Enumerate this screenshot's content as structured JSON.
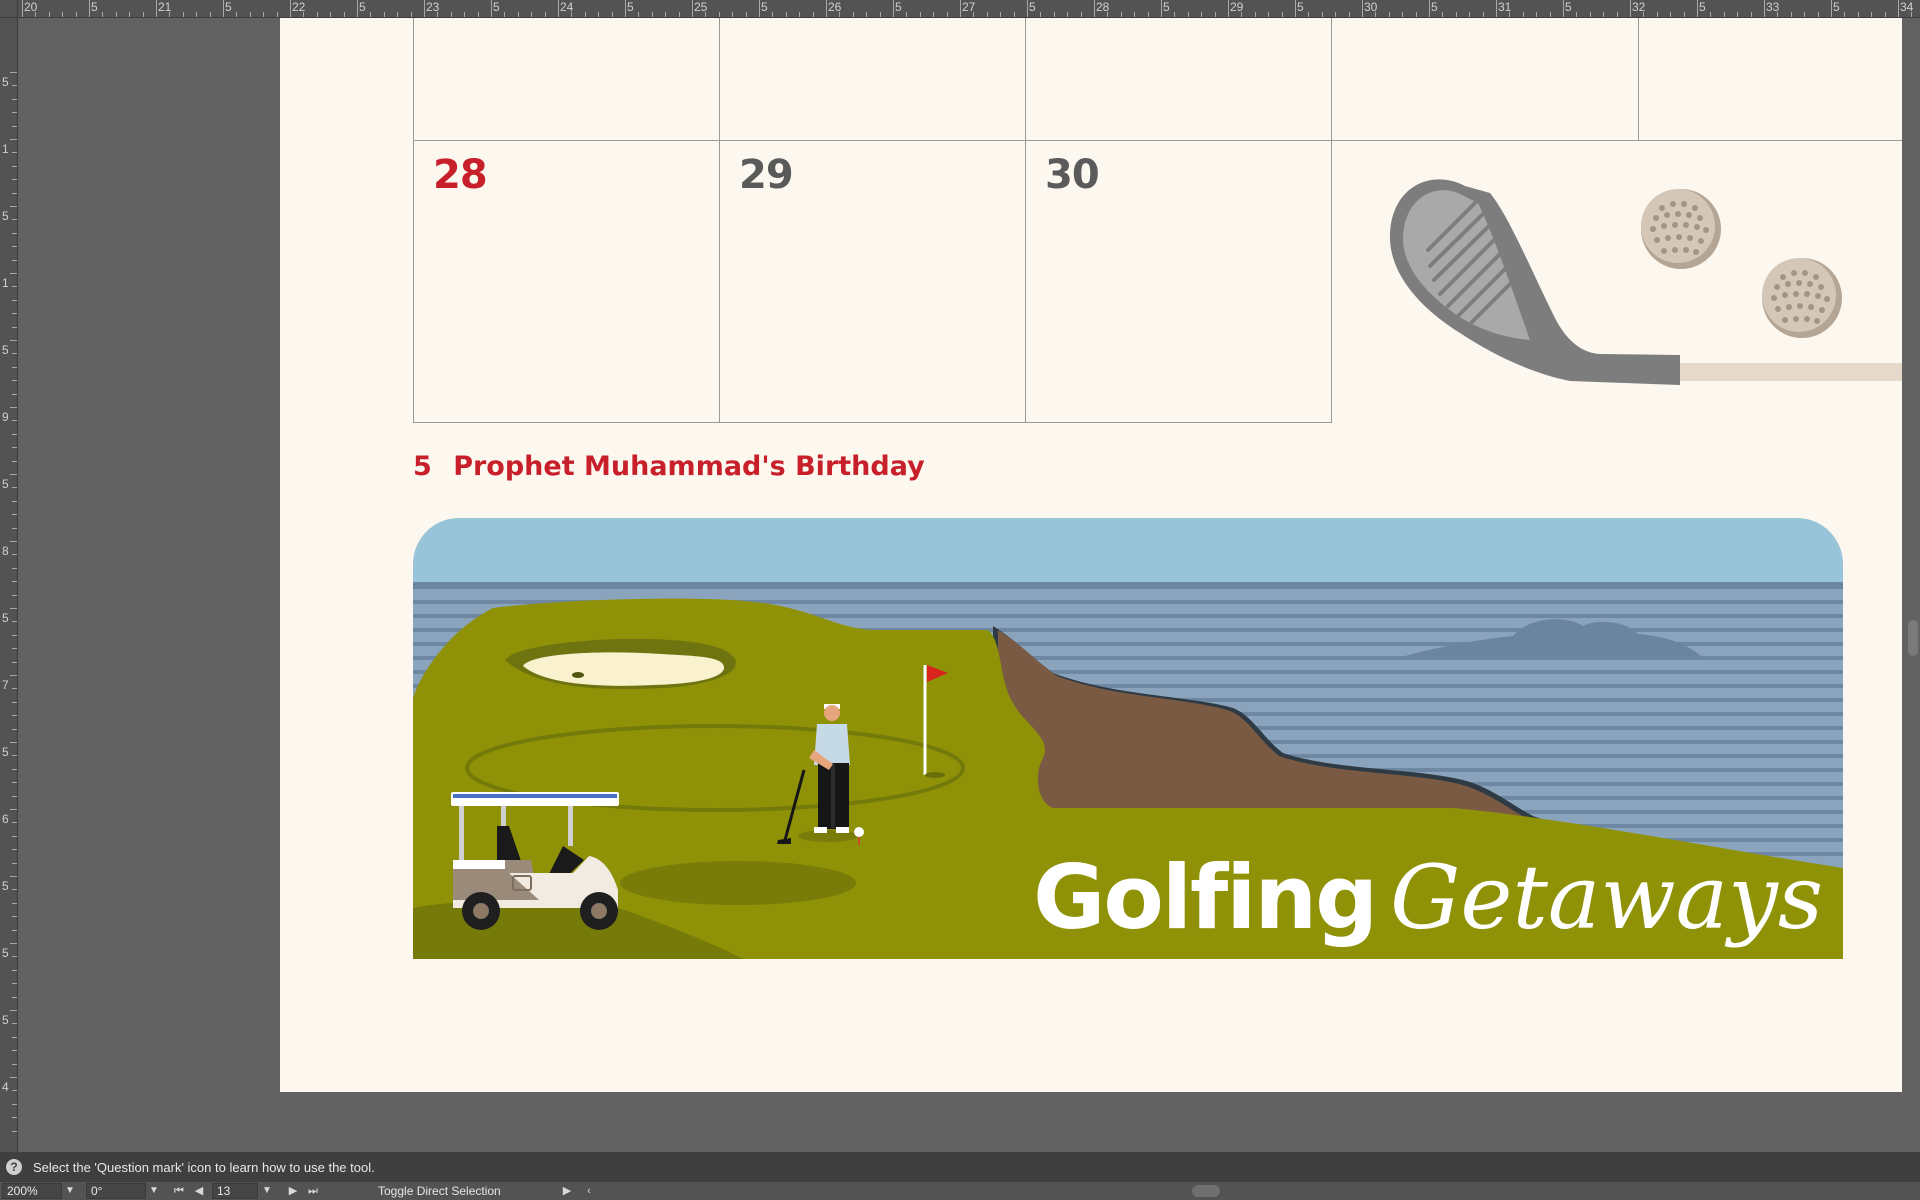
{
  "ruler_top": {
    "labels": [
      "20",
      "5",
      "21",
      "5",
      "22",
      "5",
      "23",
      "5",
      "24",
      "5",
      "25",
      "5",
      "26",
      "5",
      "27",
      "5",
      "28",
      "5",
      "29",
      "5",
      "30",
      "5",
      "31",
      "5",
      "32",
      "5",
      "33",
      "5",
      "34"
    ]
  },
  "ruler_left": {
    "labels": [
      "5",
      "1",
      "5",
      "1",
      "5",
      "9",
      "5",
      "8",
      "5",
      "7",
      "5",
      "6",
      "5",
      "5",
      "5",
      "4"
    ]
  },
  "calendar": {
    "days": [
      {
        "num": "28",
        "color": "#c8202a"
      },
      {
        "num": "29",
        "color": "#5a5a5a"
      },
      {
        "num": "30",
        "color": "#5a5a5a"
      }
    ]
  },
  "holiday": {
    "day": "5",
    "name": "Prophet Muhammad's Birthday"
  },
  "banner": {
    "title_plain": "Golfing",
    "title_italic": "Getaways"
  },
  "hint": {
    "icon": "question-mark-icon",
    "text": "Select the 'Question mark' icon to learn how to use the tool."
  },
  "status": {
    "zoom": "200%",
    "rotation": "0°",
    "page": "13",
    "tool_label": "Toggle Direct Selection"
  },
  "colors": {
    "pasteboard": "#626262",
    "page": "#fdf8ef",
    "accent_red": "#c8202a",
    "grass": "#8f9207",
    "sky": "#97c4d8",
    "water": "#7e98b0"
  }
}
